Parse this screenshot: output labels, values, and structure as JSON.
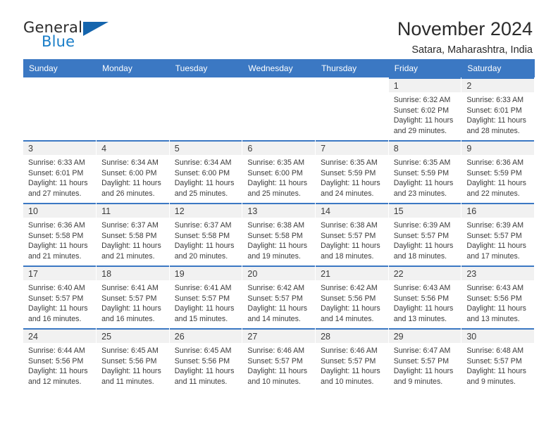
{
  "brand": {
    "name_part1": "General",
    "name_part2": "Blue",
    "accent_color": "#1a7ec8",
    "triangle_color": "#1565ad",
    "triangle_icon": "triangle-icon"
  },
  "header": {
    "title": "November 2024",
    "subtitle": "Satara, Maharashtra, India"
  },
  "theme": {
    "header_bg": "#3b78c3",
    "daynum_bg": "#f1f1f1",
    "text": "#3b3b3b"
  },
  "weekdays": [
    "Sunday",
    "Monday",
    "Tuesday",
    "Wednesday",
    "Thursday",
    "Friday",
    "Saturday"
  ],
  "weeks": [
    [
      {
        "day": "",
        "sunrise": "",
        "sunset": "",
        "daylight1": "",
        "daylight2": ""
      },
      {
        "day": "",
        "sunrise": "",
        "sunset": "",
        "daylight1": "",
        "daylight2": ""
      },
      {
        "day": "",
        "sunrise": "",
        "sunset": "",
        "daylight1": "",
        "daylight2": ""
      },
      {
        "day": "",
        "sunrise": "",
        "sunset": "",
        "daylight1": "",
        "daylight2": ""
      },
      {
        "day": "",
        "sunrise": "",
        "sunset": "",
        "daylight1": "",
        "daylight2": ""
      },
      {
        "day": "1",
        "sunrise": "Sunrise: 6:32 AM",
        "sunset": "Sunset: 6:02 PM",
        "daylight1": "Daylight: 11 hours",
        "daylight2": "and 29 minutes."
      },
      {
        "day": "2",
        "sunrise": "Sunrise: 6:33 AM",
        "sunset": "Sunset: 6:01 PM",
        "daylight1": "Daylight: 11 hours",
        "daylight2": "and 28 minutes."
      }
    ],
    [
      {
        "day": "3",
        "sunrise": "Sunrise: 6:33 AM",
        "sunset": "Sunset: 6:01 PM",
        "daylight1": "Daylight: 11 hours",
        "daylight2": "and 27 minutes."
      },
      {
        "day": "4",
        "sunrise": "Sunrise: 6:34 AM",
        "sunset": "Sunset: 6:00 PM",
        "daylight1": "Daylight: 11 hours",
        "daylight2": "and 26 minutes."
      },
      {
        "day": "5",
        "sunrise": "Sunrise: 6:34 AM",
        "sunset": "Sunset: 6:00 PM",
        "daylight1": "Daylight: 11 hours",
        "daylight2": "and 25 minutes."
      },
      {
        "day": "6",
        "sunrise": "Sunrise: 6:35 AM",
        "sunset": "Sunset: 6:00 PM",
        "daylight1": "Daylight: 11 hours",
        "daylight2": "and 25 minutes."
      },
      {
        "day": "7",
        "sunrise": "Sunrise: 6:35 AM",
        "sunset": "Sunset: 5:59 PM",
        "daylight1": "Daylight: 11 hours",
        "daylight2": "and 24 minutes."
      },
      {
        "day": "8",
        "sunrise": "Sunrise: 6:35 AM",
        "sunset": "Sunset: 5:59 PM",
        "daylight1": "Daylight: 11 hours",
        "daylight2": "and 23 minutes."
      },
      {
        "day": "9",
        "sunrise": "Sunrise: 6:36 AM",
        "sunset": "Sunset: 5:59 PM",
        "daylight1": "Daylight: 11 hours",
        "daylight2": "and 22 minutes."
      }
    ],
    [
      {
        "day": "10",
        "sunrise": "Sunrise: 6:36 AM",
        "sunset": "Sunset: 5:58 PM",
        "daylight1": "Daylight: 11 hours",
        "daylight2": "and 21 minutes."
      },
      {
        "day": "11",
        "sunrise": "Sunrise: 6:37 AM",
        "sunset": "Sunset: 5:58 PM",
        "daylight1": "Daylight: 11 hours",
        "daylight2": "and 21 minutes."
      },
      {
        "day": "12",
        "sunrise": "Sunrise: 6:37 AM",
        "sunset": "Sunset: 5:58 PM",
        "daylight1": "Daylight: 11 hours",
        "daylight2": "and 20 minutes."
      },
      {
        "day": "13",
        "sunrise": "Sunrise: 6:38 AM",
        "sunset": "Sunset: 5:58 PM",
        "daylight1": "Daylight: 11 hours",
        "daylight2": "and 19 minutes."
      },
      {
        "day": "14",
        "sunrise": "Sunrise: 6:38 AM",
        "sunset": "Sunset: 5:57 PM",
        "daylight1": "Daylight: 11 hours",
        "daylight2": "and 18 minutes."
      },
      {
        "day": "15",
        "sunrise": "Sunrise: 6:39 AM",
        "sunset": "Sunset: 5:57 PM",
        "daylight1": "Daylight: 11 hours",
        "daylight2": "and 18 minutes."
      },
      {
        "day": "16",
        "sunrise": "Sunrise: 6:39 AM",
        "sunset": "Sunset: 5:57 PM",
        "daylight1": "Daylight: 11 hours",
        "daylight2": "and 17 minutes."
      }
    ],
    [
      {
        "day": "17",
        "sunrise": "Sunrise: 6:40 AM",
        "sunset": "Sunset: 5:57 PM",
        "daylight1": "Daylight: 11 hours",
        "daylight2": "and 16 minutes."
      },
      {
        "day": "18",
        "sunrise": "Sunrise: 6:41 AM",
        "sunset": "Sunset: 5:57 PM",
        "daylight1": "Daylight: 11 hours",
        "daylight2": "and 16 minutes."
      },
      {
        "day": "19",
        "sunrise": "Sunrise: 6:41 AM",
        "sunset": "Sunset: 5:57 PM",
        "daylight1": "Daylight: 11 hours",
        "daylight2": "and 15 minutes."
      },
      {
        "day": "20",
        "sunrise": "Sunrise: 6:42 AM",
        "sunset": "Sunset: 5:57 PM",
        "daylight1": "Daylight: 11 hours",
        "daylight2": "and 14 minutes."
      },
      {
        "day": "21",
        "sunrise": "Sunrise: 6:42 AM",
        "sunset": "Sunset: 5:56 PM",
        "daylight1": "Daylight: 11 hours",
        "daylight2": "and 14 minutes."
      },
      {
        "day": "22",
        "sunrise": "Sunrise: 6:43 AM",
        "sunset": "Sunset: 5:56 PM",
        "daylight1": "Daylight: 11 hours",
        "daylight2": "and 13 minutes."
      },
      {
        "day": "23",
        "sunrise": "Sunrise: 6:43 AM",
        "sunset": "Sunset: 5:56 PM",
        "daylight1": "Daylight: 11 hours",
        "daylight2": "and 13 minutes."
      }
    ],
    [
      {
        "day": "24",
        "sunrise": "Sunrise: 6:44 AM",
        "sunset": "Sunset: 5:56 PM",
        "daylight1": "Daylight: 11 hours",
        "daylight2": "and 12 minutes."
      },
      {
        "day": "25",
        "sunrise": "Sunrise: 6:45 AM",
        "sunset": "Sunset: 5:56 PM",
        "daylight1": "Daylight: 11 hours",
        "daylight2": "and 11 minutes."
      },
      {
        "day": "26",
        "sunrise": "Sunrise: 6:45 AM",
        "sunset": "Sunset: 5:56 PM",
        "daylight1": "Daylight: 11 hours",
        "daylight2": "and 11 minutes."
      },
      {
        "day": "27",
        "sunrise": "Sunrise: 6:46 AM",
        "sunset": "Sunset: 5:57 PM",
        "daylight1": "Daylight: 11 hours",
        "daylight2": "and 10 minutes."
      },
      {
        "day": "28",
        "sunrise": "Sunrise: 6:46 AM",
        "sunset": "Sunset: 5:57 PM",
        "daylight1": "Daylight: 11 hours",
        "daylight2": "and 10 minutes."
      },
      {
        "day": "29",
        "sunrise": "Sunrise: 6:47 AM",
        "sunset": "Sunset: 5:57 PM",
        "daylight1": "Daylight: 11 hours",
        "daylight2": "and 9 minutes."
      },
      {
        "day": "30",
        "sunrise": "Sunrise: 6:48 AM",
        "sunset": "Sunset: 5:57 PM",
        "daylight1": "Daylight: 11 hours",
        "daylight2": "and 9 minutes."
      }
    ]
  ]
}
